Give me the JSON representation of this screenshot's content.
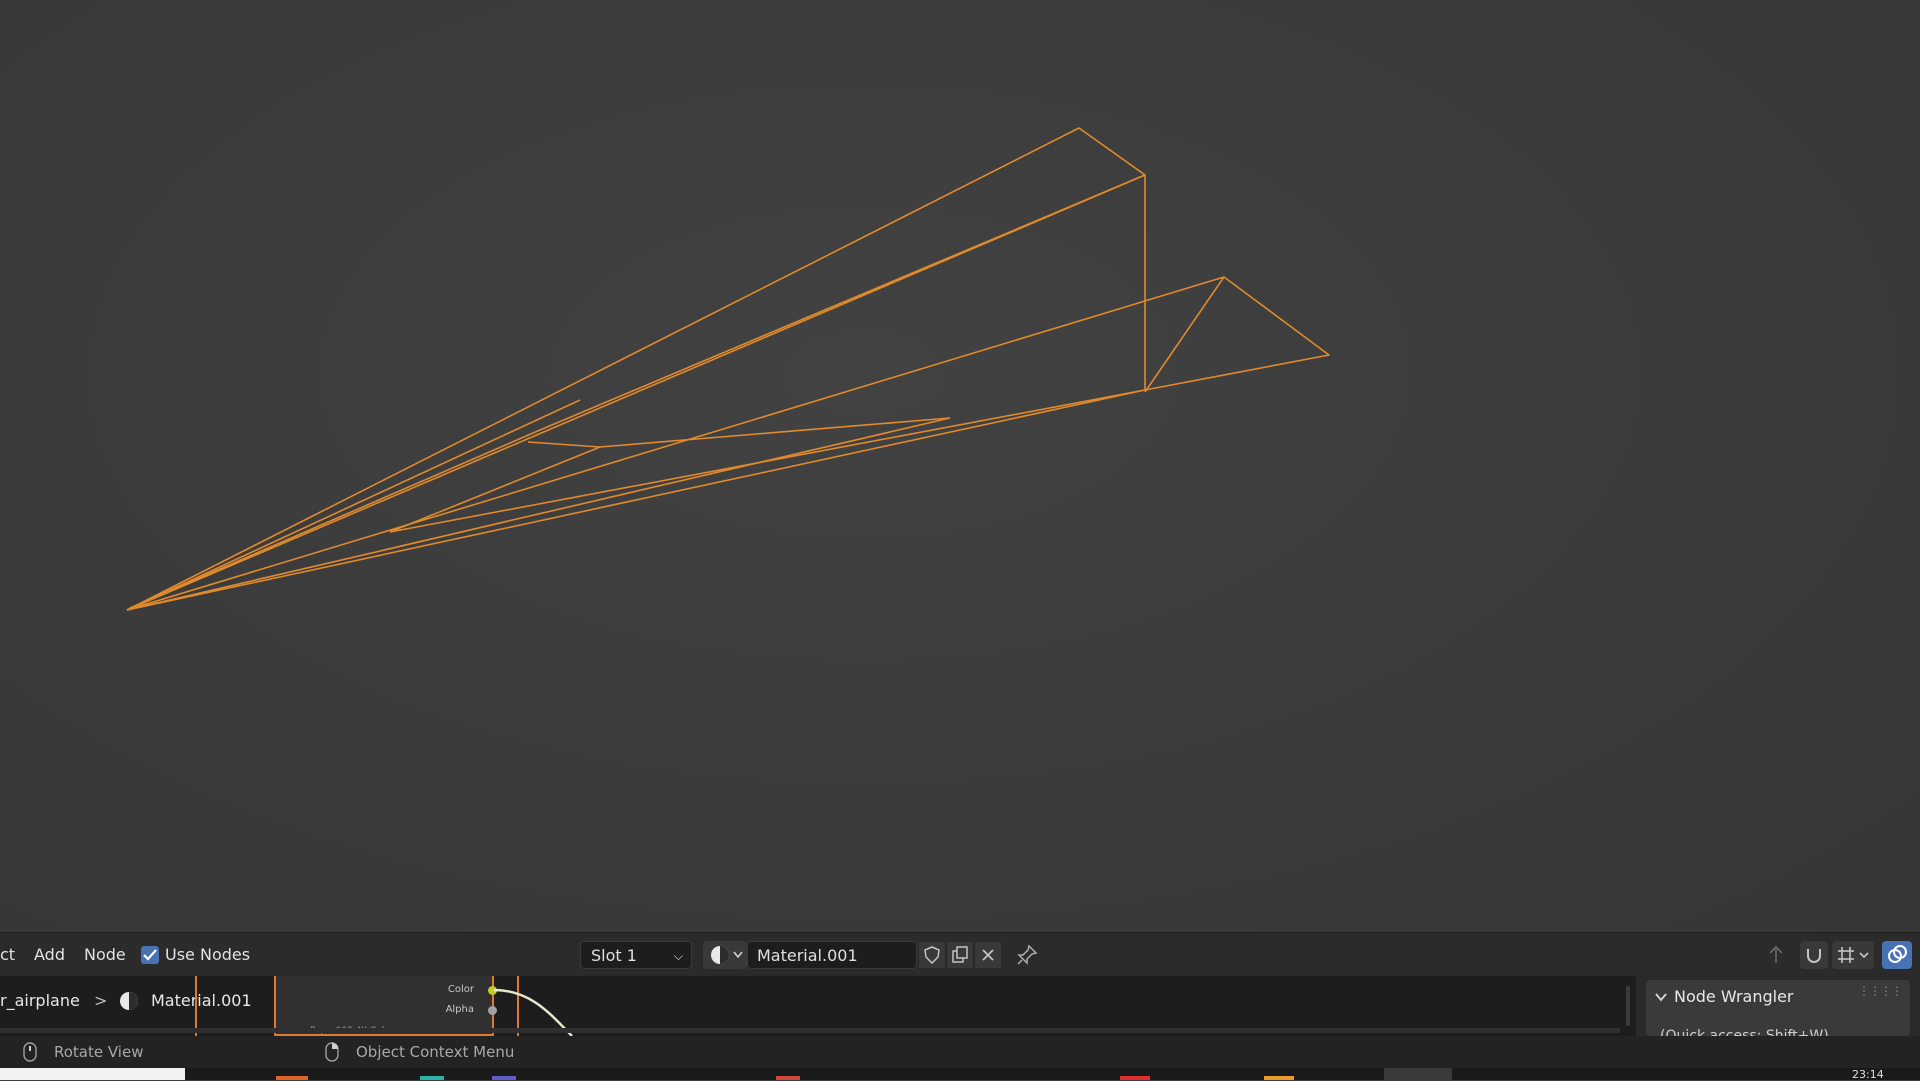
{
  "node_header": {
    "menu_select_partial": "ct",
    "menu_add": "Add",
    "menu_node": "Node",
    "use_nodes_label": "Use Nodes",
    "slot_value": "Slot 1",
    "material_name": "Material.001"
  },
  "node_editor": {
    "breadcrumb_object": "r_airplane",
    "breadcrumb_separator": ">",
    "breadcrumb_material": "Material.001",
    "node_socket_color": "Color",
    "node_socket_alpha": "Alpha",
    "node_footer_partial": "Paper003 4K Colo"
  },
  "sidepanel": {
    "title": "Node Wrangler",
    "subtitle_partial": "(Quick access: Shift+W)"
  },
  "statusbar": {
    "hint_left": "Rotate View",
    "hint_right": "Object Context Menu"
  },
  "taskbar": {
    "clock_partial": "23:14"
  },
  "colors": {
    "wire": "#e08a2c",
    "accent_blue": "#4772b3",
    "node_select": "#e07a2e"
  }
}
